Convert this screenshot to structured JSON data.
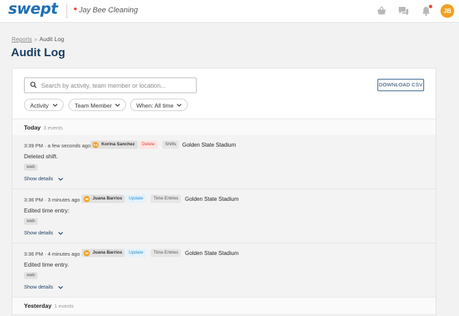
{
  "app": {
    "logo": "swept",
    "org_name": "Jay Bee Cleaning",
    "avatar_initials": "JB"
  },
  "topbar_icons": [
    "basket-icon",
    "chat-icon",
    "bell-icon"
  ],
  "breadcrumb": {
    "parent": "Reports",
    "separator": "»",
    "current": "Audit Log"
  },
  "page_title": "Audit Log",
  "search": {
    "placeholder": "Search by activity, team member or location...",
    "value": ""
  },
  "download_label": "DOWNLOAD CSV",
  "filters": {
    "activity": "Activity",
    "team_member": "Team Member",
    "when": "When: All time"
  },
  "groups": {
    "today": {
      "label": "Today",
      "count": "3 events"
    },
    "yesterday": {
      "label": "Yesterday",
      "count": "1 events"
    }
  },
  "events": [
    {
      "time": "3:39 PM · a few seconds ago",
      "user_initials": "KS",
      "user": "Korina Sanchez",
      "action": "Delete",
      "category": "Shifts",
      "location": "Golden State Stadium",
      "description": "Deleted shift.",
      "source": "web",
      "show_details": "Show details"
    },
    {
      "time": "3:36 PM · 3 minutes ago",
      "user_initials": "JB",
      "user": "Juana Barrios",
      "action": "Update",
      "category": "Time Entries",
      "location": "Golden State Stadium",
      "description": "Edited time entry:",
      "source": "web",
      "show_details": "Show details"
    },
    {
      "time": "3:36 PM · 4 minutes ago",
      "user_initials": "JB",
      "user": "Juana Barrios",
      "action": "Update",
      "category": "Time Entries",
      "location": "Golden State Stadium",
      "description": "Edited time entry.",
      "source": "web",
      "show_details": "Show details"
    }
  ],
  "colors": {
    "brand": "#1f6fb2",
    "title": "#1c3f66",
    "delete": "#d9453a",
    "update": "#2d8fcc",
    "avatar": "#f0a121"
  }
}
